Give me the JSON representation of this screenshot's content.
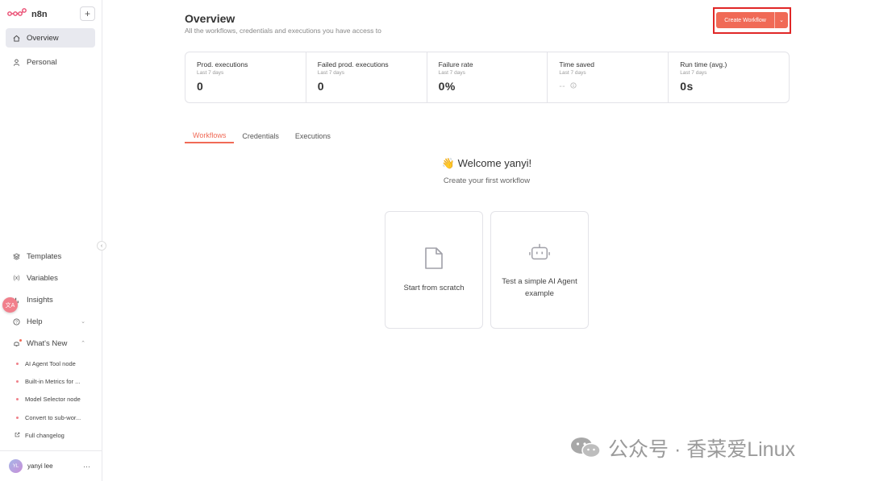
{
  "app": {
    "name": "n8n",
    "plus": "+"
  },
  "sidebar": {
    "top_items": [
      {
        "label": "Overview",
        "icon": "home-icon"
      },
      {
        "label": "Personal",
        "icon": "user-icon"
      }
    ],
    "bottom_items": [
      {
        "label": "Templates",
        "icon": "templates-icon"
      },
      {
        "label": "Variables",
        "icon": "variables-icon"
      },
      {
        "label": "Insights",
        "icon": "insights-icon"
      },
      {
        "label": "Help",
        "icon": "help-icon"
      },
      {
        "label": "What's New",
        "icon": "bell-icon"
      }
    ],
    "whats_new": [
      "AI Agent Tool node",
      "Built-in Metrics for ...",
      "Model Selector node",
      "Convert to sub-wor..."
    ],
    "changelog": "Full changelog",
    "user": {
      "initials": "YL",
      "name": "yanyi lee",
      "more": "···"
    },
    "translate_badge": "文A"
  },
  "header": {
    "title": "Overview",
    "subtitle": "All the workflows, credentials and executions you have access to",
    "create_button": "Create Workflow"
  },
  "stats": [
    {
      "label": "Prod. executions",
      "period": "Last 7 days",
      "value": "0"
    },
    {
      "label": "Failed prod. executions",
      "period": "Last 7 days",
      "value": "0"
    },
    {
      "label": "Failure rate",
      "period": "Last 7 days",
      "value": "0%"
    },
    {
      "label": "Time saved",
      "period": "Last 7 days",
      "value": "--"
    },
    {
      "label": "Run time (avg.)",
      "period": "Last 7 days",
      "value": "0s"
    }
  ],
  "tabs": [
    "Workflows",
    "Credentials",
    "Executions"
  ],
  "welcome": {
    "emoji": "👋",
    "title": "Welcome yanyi!",
    "subtitle": "Create your first workflow"
  },
  "cards": [
    {
      "label": "Start from scratch",
      "icon": "file-icon"
    },
    {
      "label": "Test a simple AI Agent example",
      "icon": "robot-icon"
    }
  ],
  "watermark": "公众号 · 香菜爱Linux",
  "colors": {
    "accent": "#f06a56",
    "highlight": "#e02727",
    "active_nav": "#e8e9ef"
  }
}
